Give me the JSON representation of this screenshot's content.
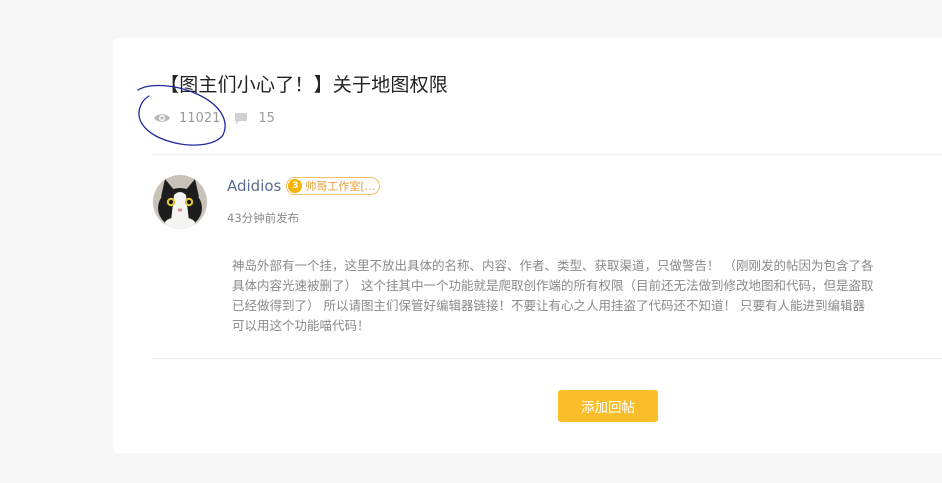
{
  "post": {
    "title": "【图主们小心了！】关于地图权限",
    "stats": {
      "views": "11021",
      "comments": "15",
      "views_icon": "eye-icon",
      "comments_icon": "comment-icon"
    },
    "author": {
      "name": "Adidios",
      "badge_level": "3",
      "badge_label": "帅哥工作室[...",
      "time": "43分钟前发布"
    },
    "body_lines": [
      "神岛外部有一个挂，这里不放出具体的名称、内容、作者、类型、获取渠道，只做警告！ （刚刚发的帖因为包含了各",
      "具体内容光速被删了） 这个挂其中一个功能就是爬取创作端的所有权限（目前还无法做到修改地图和代码，但是盗取",
      "已经做得到了） 所以请图主们保管好编辑器链接！不要让有心之人用挂盗了代码还不知道！ 只要有人能进到编辑器",
      "可以用这个功能喵代码！"
    ]
  },
  "actions": {
    "add_reply": "添加回帖"
  },
  "colors": {
    "accent": "#fbbe2b",
    "author_name": "#5b6b8b",
    "annotation_ink": "#1e2a9c"
  }
}
